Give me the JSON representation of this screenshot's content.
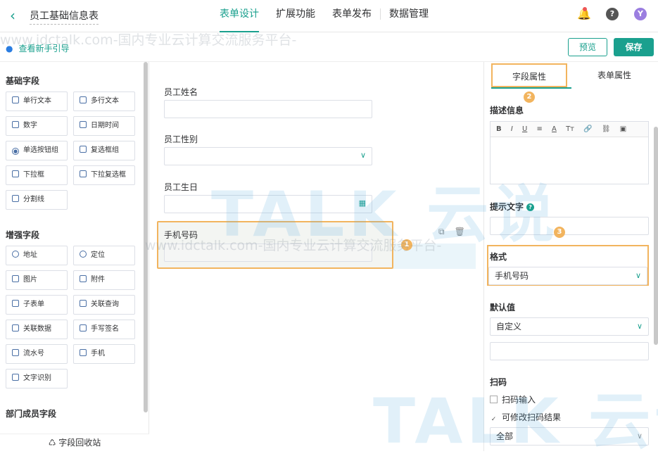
{
  "header": {
    "title": "员工基础信息表",
    "tabs": [
      {
        "label": "表单设计"
      },
      {
        "label": "扩展功能"
      },
      {
        "label": "表单发布"
      },
      {
        "label": "数据管理"
      }
    ],
    "avatar_letter": "Y",
    "help_glyph": "?"
  },
  "subbar": {
    "guide_link": "查看新手引导",
    "preview_label": "预览",
    "save_label": "保存"
  },
  "left": {
    "basic_title": "基础字段",
    "basic_fields": [
      "单行文本",
      "多行文本",
      "数字",
      "日期时间",
      "单选按钮组",
      "复选框组",
      "下拉框",
      "下拉复选框",
      "分割线"
    ],
    "enhanced_title": "增强字段",
    "enhanced_fields": [
      "地址",
      "定位",
      "图片",
      "附件",
      "子表单",
      "关联查询",
      "关联数据",
      "手写签名",
      "流水号",
      "手机",
      "文字识别"
    ],
    "dept_title": "部门成员字段",
    "recycle_label": "字段回收站"
  },
  "canvas": {
    "fields": [
      {
        "label": "员工姓名"
      },
      {
        "label": "员工性别"
      },
      {
        "label": "员工生日"
      },
      {
        "label": "手机号码"
      }
    ]
  },
  "badges": [
    "1",
    "2",
    "3"
  ],
  "panel": {
    "tab_field": "字段属性",
    "tab_form": "表单属性",
    "desc_label": "描述信息",
    "toolbar": [
      "B",
      "I",
      "U",
      "≡",
      "A",
      "Tт",
      "🔗",
      "⛓",
      "▣"
    ],
    "hint_label": "提示文字",
    "format_label": "格式",
    "format_value": "手机号码",
    "default_label": "默认值",
    "default_value": "自定义",
    "scan_label": "扫码",
    "scan_input": "扫码输入",
    "scan_modify": "可修改扫码结果",
    "scan_scope": "全部"
  },
  "watermark": {
    "text": "www.idctalk.com-国内专业云计算交流服务平台-",
    "logo": "TALK 云说"
  }
}
